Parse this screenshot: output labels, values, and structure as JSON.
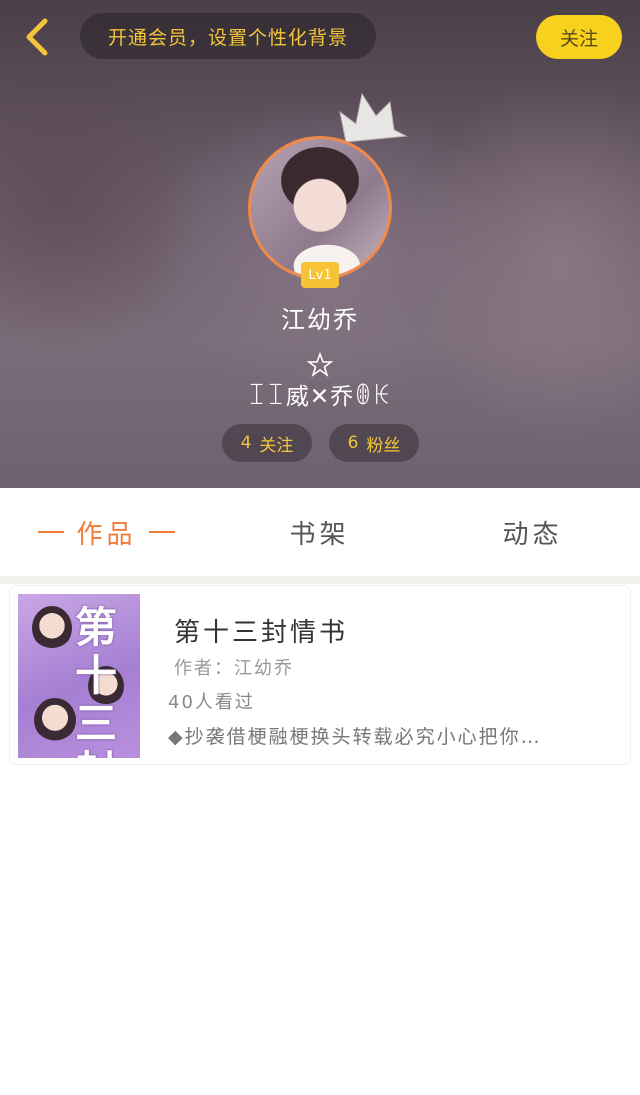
{
  "colors": {
    "accent": "#f07b3a",
    "gold": "#f3c53a",
    "follow_button": "#f7d11e",
    "cover_purple": "#a57fd2"
  },
  "header": {
    "vip_prompt": "开通会员，设置个性化背景",
    "follow_label": "关注",
    "level_badge": "Lv1",
    "username": "江幼乔",
    "signature": "ꀤꀤ威✕乔ꂦꀘ",
    "stats": {
      "following_count": "4",
      "following_label": "关注",
      "fans_count": "6",
      "fans_label": "粉丝"
    },
    "icons": [
      "back-chevron-icon",
      "crown-icon",
      "star-icon"
    ]
  },
  "tabs": [
    {
      "label": "作品",
      "active": true
    },
    {
      "label": "书架",
      "active": false
    },
    {
      "label": "动态",
      "active": false
    }
  ],
  "works": [
    {
      "title": "第十三封情书",
      "author": "作者：江幼乔",
      "views": "40人看过",
      "description": "◆抄袭借梗融梗换头转载必究小心把你…",
      "cover_title": "第十三封情书"
    }
  ]
}
